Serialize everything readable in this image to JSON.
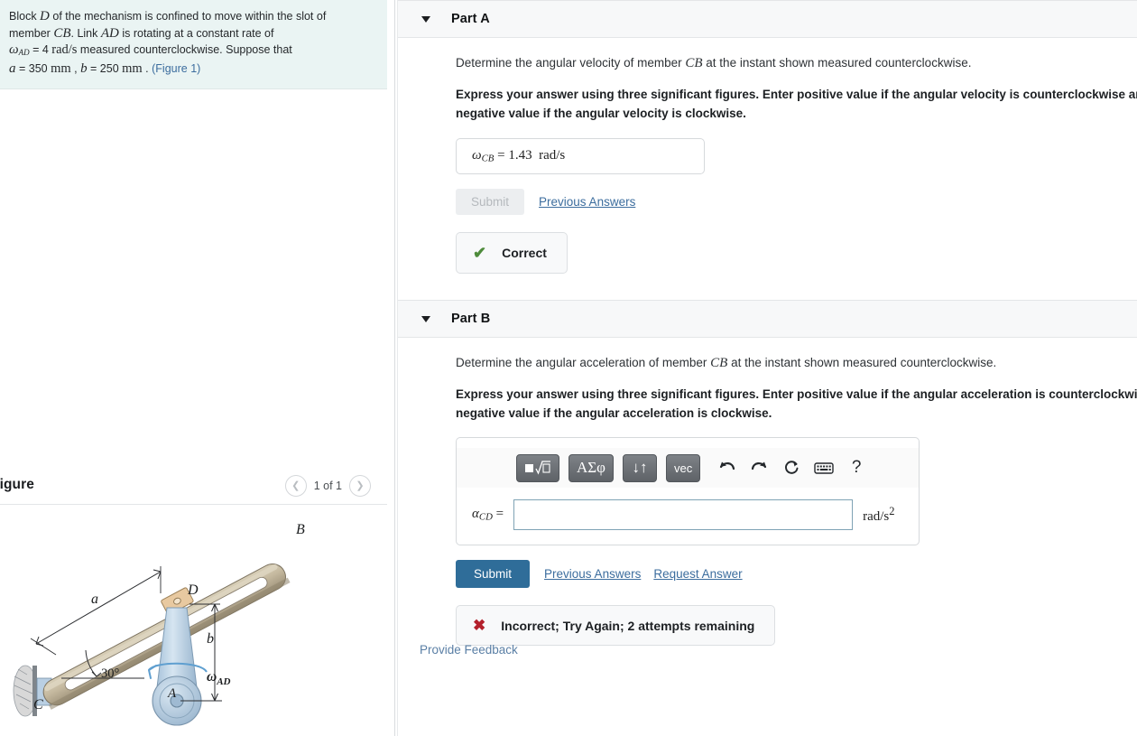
{
  "problem": {
    "line1_a": "Block ",
    "line1_D": "D",
    "line1_b": " of the mechanism is confined to move within the slot of",
    "line2_a": "member ",
    "line2_CB": "CB",
    "line2_b": ". Link ",
    "line2_AD": "AD",
    "line2_c": " is rotating at a constant rate of",
    "omega_sym": "ω",
    "omega_sub": "AD",
    "omega_eq": " = 4 ",
    "omega_units": "rad/s",
    "line3_rest": " measured counterclockwise. Suppose that",
    "a_sym": "a",
    "a_eq": " = 350 ",
    "a_units": "mm",
    "comma": " , ",
    "b_sym": "b",
    "b_eq": " = 250 ",
    "b_units": "mm",
    "period": " . ",
    "figure_link": "(Figure 1)"
  },
  "figure_panel": {
    "title": "Figure",
    "page_label": "1 of 1",
    "prev_icon": "chevron-left-icon",
    "next_icon": "chevron-right-icon",
    "labels": {
      "B": "B",
      "C": "C",
      "D": "D",
      "A": "A",
      "a": "a",
      "b": "b",
      "angle": "30°",
      "omega": "ω",
      "omega_sub": "AD"
    },
    "colors": {
      "bar": "#bdb094",
      "bar_dark": "#8e836c",
      "bar_light": "#d8cfb8",
      "block": "#e8c9a0",
      "link": "#b9cfe3",
      "link_dark": "#8fadc6",
      "arrow": "#5f9fd0",
      "wall": "#9aa0a6"
    }
  },
  "partA": {
    "caret_icon": "caret-down-icon",
    "title": "Part A",
    "question": "Determine the angular velocity of member CB at the instant shown measured counterclockwise.",
    "question_pre": "Determine the angular velocity of member ",
    "question_var": "CB",
    "question_post": " at the instant shown measured counterclockwise.",
    "instruction": "Express your answer using three significant figures. Enter positive value if the angular velocity is counterclockwise and negative value if the angular velocity is clockwise.",
    "answer_symbol": "ω",
    "answer_sub": "CB",
    "answer_eq": " = ",
    "answer_value": "1.43",
    "answer_units": "rad/s",
    "submit_label": "Submit",
    "previous_answers_label": "Previous Answers",
    "feedback_icon": "check-icon",
    "feedback_text": "Correct"
  },
  "partB": {
    "caret_icon": "caret-down-icon",
    "title": "Part B",
    "question_pre": "Determine the angular acceleration of member ",
    "question_var": "CB",
    "question_post": " at the instant shown measured counterclockwise.",
    "instruction": "Express your answer using three significant figures. Enter positive value if the angular acceleration is counterclockwise and negative value if the angular acceleration is clockwise.",
    "toolbar": [
      {
        "name": "template-sqrt-button",
        "label": "■√□"
      },
      {
        "name": "greek-letters-button",
        "label": "ΑΣφ"
      },
      {
        "name": "arrows-button",
        "label": "↓↑"
      },
      {
        "name": "vector-button",
        "label": "vec"
      },
      {
        "name": "undo-icon",
        "label": "↶"
      },
      {
        "name": "redo-icon",
        "label": "↷"
      },
      {
        "name": "reset-icon",
        "label": "↻"
      },
      {
        "name": "keyboard-icon",
        "label": "⌨"
      },
      {
        "name": "help-icon",
        "label": "?"
      }
    ],
    "input_symbol": "α",
    "input_sub": "CD",
    "input_eq": " = ",
    "input_value": "",
    "input_placeholder": "",
    "input_units_base": "rad/s",
    "input_units_exp": "2",
    "submit_label": "Submit",
    "previous_answers_label": "Previous Answers",
    "request_answer_label": "Request Answer",
    "feedback_icon": "cross-icon",
    "feedback_text": "Incorrect; Try Again; 2 attempts remaining"
  },
  "footer": {
    "provide_feedback_label": "Provide Feedback"
  },
  "colors": {
    "accent": "#2f6d99",
    "link": "#3c6d9e",
    "correct": "#4e8b3b",
    "incorrect": "#b3202c",
    "problem_bg": "#eaf4f3",
    "header_bg": "#f7f8f9"
  }
}
